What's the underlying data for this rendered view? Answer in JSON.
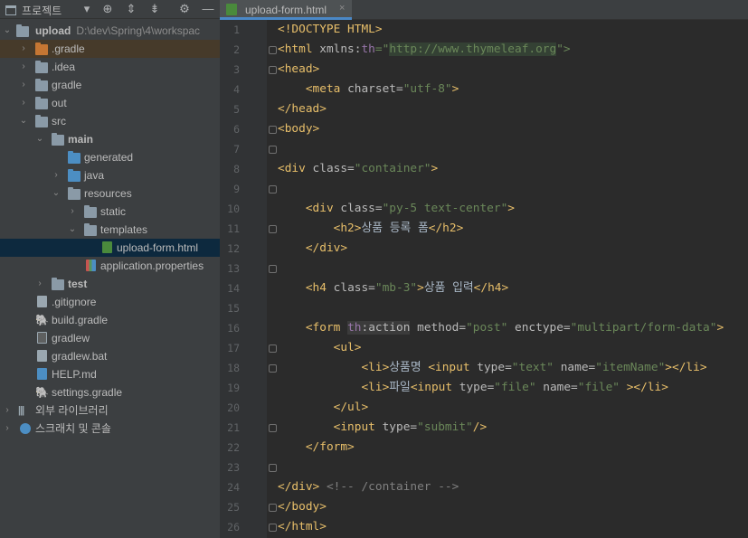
{
  "project_panel": {
    "title": "프로젝트",
    "toolbar_icons": [
      "chevron-down-icon",
      "locate-icon",
      "expand-all-icon",
      "collapse-all-icon",
      "gear-icon",
      "minimize-icon"
    ],
    "tree": [
      {
        "label": "upload",
        "path": "D:\\dev\\Spring\\4\\workspac",
        "type": "module",
        "expanded": true
      },
      {
        "label": ".gradle",
        "type": "folder-excluded",
        "expanded": false
      },
      {
        "label": ".idea",
        "type": "folder",
        "expanded": false
      },
      {
        "label": "gradle",
        "type": "folder",
        "expanded": false
      },
      {
        "label": "out",
        "type": "folder-excluded",
        "expanded": false
      },
      {
        "label": "src",
        "type": "folder",
        "expanded": true
      },
      {
        "label": "main",
        "type": "folder",
        "expanded": true
      },
      {
        "label": "generated",
        "type": "folder-generated"
      },
      {
        "label": "java",
        "type": "folder-source",
        "expanded": false
      },
      {
        "label": "resources",
        "type": "folder-resources",
        "expanded": true
      },
      {
        "label": "static",
        "type": "folder",
        "expanded": false
      },
      {
        "label": "templates",
        "type": "folder",
        "expanded": true
      },
      {
        "label": "upload-form.html",
        "type": "file-html",
        "selected": true
      },
      {
        "label": "application.properties",
        "type": "file-properties"
      },
      {
        "label": "test",
        "type": "folder",
        "expanded": false
      },
      {
        "label": ".gitignore",
        "type": "file-text"
      },
      {
        "label": "build.gradle",
        "type": "file-gradle"
      },
      {
        "label": "gradlew",
        "type": "file-shell"
      },
      {
        "label": "gradlew.bat",
        "type": "file-bat"
      },
      {
        "label": "HELP.md",
        "type": "file-md"
      },
      {
        "label": "settings.gradle",
        "type": "file-gradle"
      },
      {
        "label": "외부 라이브러리",
        "type": "external-libraries",
        "expanded": false
      },
      {
        "label": "스크래치 및 콘솔",
        "type": "scratches",
        "expanded": false
      }
    ]
  },
  "editor": {
    "tab": {
      "label": "upload-form.html",
      "close": "×"
    },
    "line_numbers": [
      "1",
      "2",
      "3",
      "4",
      "5",
      "6",
      "7",
      "8",
      "9",
      "10",
      "11",
      "12",
      "13",
      "14",
      "15",
      "16",
      "17",
      "18",
      "19",
      "20",
      "21",
      "22",
      "23",
      "24",
      "25",
      "26"
    ],
    "code": {
      "l1": "<!DOCTYPE HTML>",
      "l2_open": "<html ",
      "l2_attr": "xmlns:",
      "l2_ns": "th",
      "l2_eq": "=\"",
      "l2_url": "http://www.thymeleaf.org",
      "l2_close": "\">",
      "l3": "<head>",
      "l4_tag": "<meta ",
      "l4_attr": "charset=",
      "l4_val": "\"utf-8\"",
      "l4_close": ">",
      "l5": "</head>",
      "l6": "<body>",
      "l8_tag": "<div ",
      "l8_attr": "class=",
      "l8_val": "\"container\"",
      "l8_close": ">",
      "l10_tag": "<div ",
      "l10_attr": "class=",
      "l10_val": "\"py-5 text-center\"",
      "l10_close": ">",
      "l11_open": "<h2>",
      "l11_text": "상품 등록 폼",
      "l11_close": "</h2>",
      "l12": "</div>",
      "l14_tag": "<h4 ",
      "l14_attr": "class=",
      "l14_val": "\"mb-3\"",
      "l14_gt": ">",
      "l14_text": "상품 입력",
      "l14_close": "</h4>",
      "l16_tag": "<form ",
      "l16_ns": "th",
      "l16_attr1": ":action",
      "l16_attr2": " method=",
      "l16_val2": "\"post\"",
      "l16_attr3": " enctype=",
      "l16_val3": "\"multipart/form-data\"",
      "l16_close": ">",
      "l17": "<ul>",
      "l18_li": "<li>",
      "l18_text": "상품명 ",
      "l18_tag": "<input ",
      "l18_attr1": "type=",
      "l18_val1": "\"text\"",
      "l18_attr2": " name=",
      "l18_val2": "\"itemName\"",
      "l18_close": "></li>",
      "l19_li": "<li>",
      "l19_text": "파일",
      "l19_tag": "<input ",
      "l19_attr1": "type=",
      "l19_val1": "\"file\"",
      "l19_attr2": " name=",
      "l19_val2": "\"file\"",
      "l19_close": " ></li>",
      "l20": "</ul>",
      "l21_tag": "<input ",
      "l21_attr": "type=",
      "l21_val": "\"submit\"",
      "l21_close": "/>",
      "l22": "</form>",
      "l24_tag": "</div>",
      "l24_cmt": " <!-- /container -->",
      "l25": "</body>",
      "l26": "</html>"
    }
  }
}
